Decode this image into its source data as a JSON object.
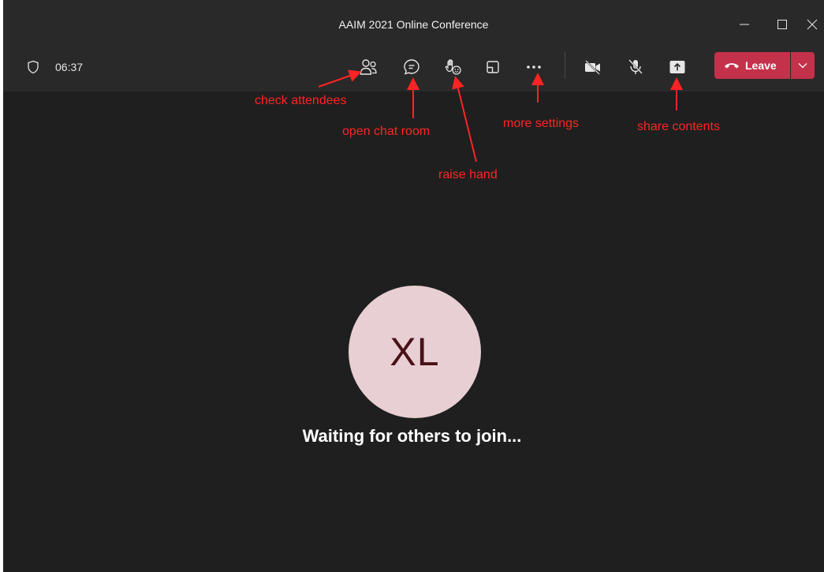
{
  "window": {
    "title": "AAIM 2021 Online Conference"
  },
  "toolbar": {
    "timer": "06:37",
    "leave_label": "Leave"
  },
  "stage": {
    "avatar_initials": "XL",
    "waiting_message": "Waiting for others to join..."
  },
  "annotations": {
    "check_attendees": "check attendees",
    "open_chat_room": "open chat room",
    "raise_hand": "raise hand",
    "more_settings": "more settings",
    "share_contents": "share contents"
  },
  "colors": {
    "leave_red": "#c4314b",
    "annotation_red": "#ff2424",
    "avatar_bg": "#e8cfd3",
    "avatar_text": "#4a1118"
  }
}
